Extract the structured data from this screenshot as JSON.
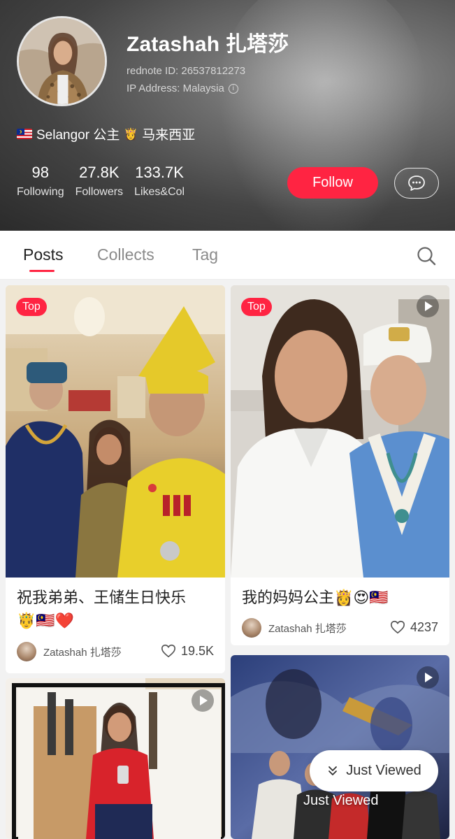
{
  "profile": {
    "name": "Zatashah 扎塔莎",
    "rednote_id": "rednote ID: 26537812273",
    "ip_address": "IP Address: Malaysia",
    "bio": "Selangor 公主",
    "bio_suffix": "马来西亚"
  },
  "stats": [
    {
      "value": "98",
      "label": "Following"
    },
    {
      "value": "27.8K",
      "label": "Followers"
    },
    {
      "value": "133.7K",
      "label": "Likes&Col"
    }
  ],
  "actions": {
    "follow_label": "Follow"
  },
  "tabs": [
    {
      "label": "Posts",
      "active": true
    },
    {
      "label": "Collects",
      "active": false
    },
    {
      "label": "Tag",
      "active": false
    }
  ],
  "posts": [
    {
      "badge": "Top",
      "title_line1": "祝我弟弟、王储生日快乐",
      "title_line2": "🤴🇲🇾❤️",
      "author": "Zatashah 扎塔莎",
      "likes": "19.5K",
      "video": false
    },
    {
      "badge": "Top",
      "title_line1": "我的妈妈公主👸😍🇲🇾",
      "author": "Zatashah 扎塔莎",
      "likes": "4237",
      "video": true
    },
    {
      "video": true
    },
    {
      "video": true
    }
  ],
  "just_viewed": {
    "pill_label": "Just Viewed",
    "overlay_label": "Just Viewed"
  },
  "colors": {
    "accent": "#ff2442",
    "tab_active": "#222222",
    "tab_inactive": "#8a8a8a"
  },
  "icons": {
    "info": "info-icon",
    "message": "chat-bubble-icon",
    "search": "search-icon",
    "heart": "heart-icon",
    "play": "play-icon",
    "chevrons": "double-chevron-down-icon"
  }
}
